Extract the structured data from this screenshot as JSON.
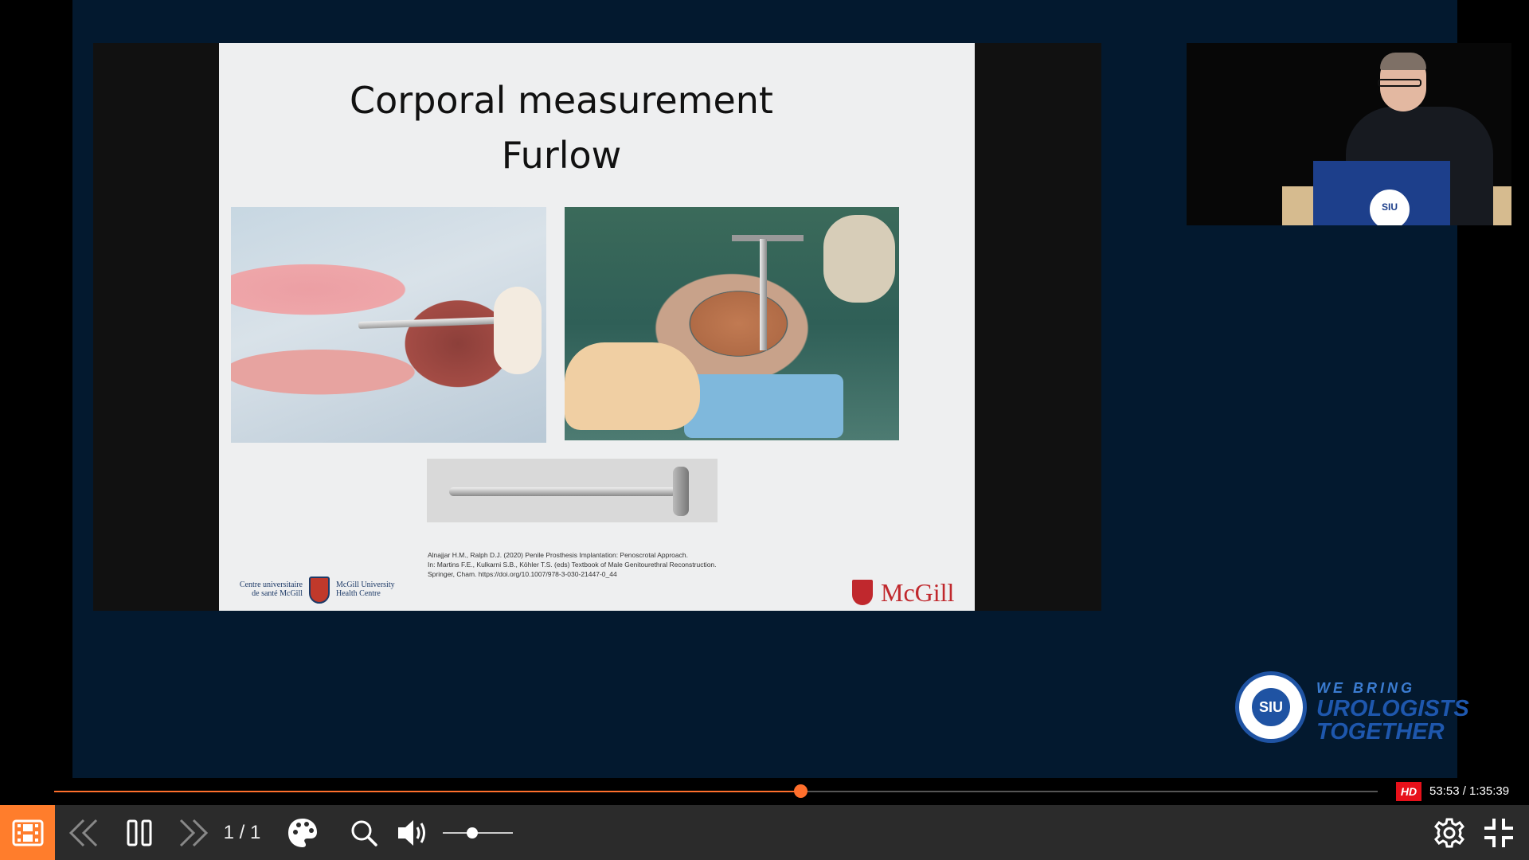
{
  "slide": {
    "title_line1": "Corporal measurement",
    "title_line2": "Furlow",
    "citation_line1": "Alnajjar H.M., Ralph D.J. (2020) Penile Prosthesis Implantation: Penoscrotal Approach.",
    "citation_line2": "In: Martins F.E., Kulkarni S.B., Köhler T.S. (eds) Textbook of Male Genitourethral Reconstruction.",
    "citation_line3": "Springer, Cham. https://doi.org/10.1007/978-3-030-21447-0_44",
    "muhc_left_line1": "Centre universitaire",
    "muhc_left_line2": "de santé McGill",
    "muhc_right_line1": "McGill University",
    "muhc_right_line2": "Health Centre",
    "mcgill_logo": "McGill"
  },
  "speaker_video": {
    "podium_seal_text": "SIU"
  },
  "branding": {
    "seal_text": "SIU",
    "tagline_line1": "WE BRING",
    "tagline_line2": "UROLOGISTS",
    "tagline_line3": "TOGETHER"
  },
  "player": {
    "progress_fraction": 0.5636,
    "hd_badge": "HD",
    "time_display": "53:53 / 1:35:39",
    "page_counter": "1 / 1",
    "volume_fraction": 0.42,
    "accent_color": "#ff6f2c",
    "icons": [
      "chapters-icon",
      "previous-icon",
      "pause-icon",
      "next-icon",
      "palette-icon",
      "search-icon",
      "volume-icon",
      "settings-icon",
      "exit-fullscreen-icon"
    ]
  }
}
